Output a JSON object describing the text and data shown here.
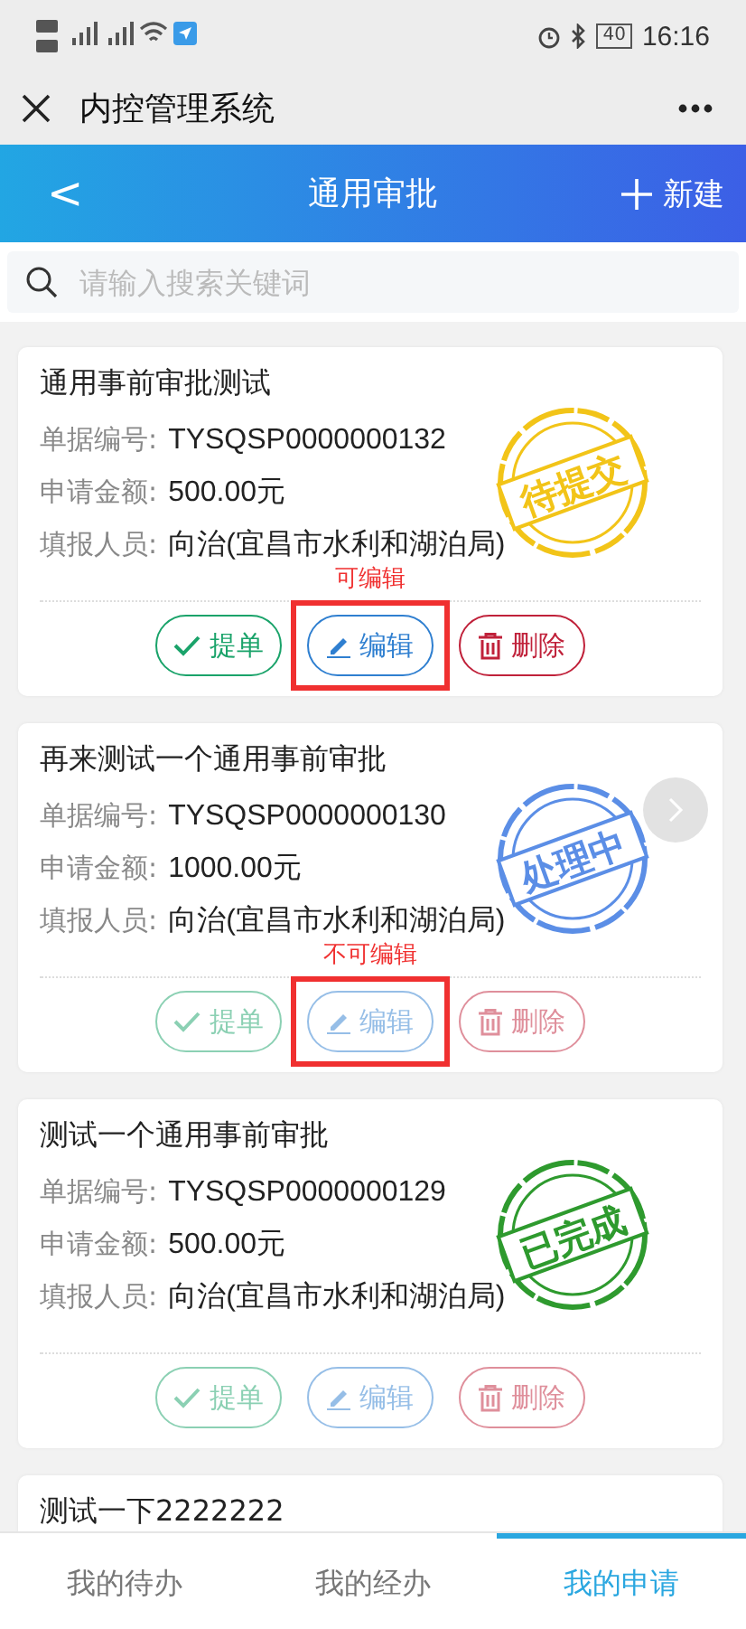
{
  "status_bar": {
    "battery": "40",
    "time": "16:16"
  },
  "title_bar": {
    "title": "内控管理系统"
  },
  "header": {
    "back": "<",
    "title": "通用审批",
    "new_label": "新建"
  },
  "search": {
    "placeholder": "请输入搜索关键词"
  },
  "cards": [
    {
      "title": "通用事前审批测试",
      "fields": [
        {
          "label": "单据编号:",
          "value": "TYSQSP0000000132"
        },
        {
          "label": "申请金额:",
          "value": "500.00元"
        },
        {
          "label": "填报人员:",
          "value": "向治(宜昌市水利和湖泊局)"
        }
      ],
      "stamp": {
        "text": "待提交",
        "color": "#f2c418"
      },
      "annotation": "可编辑",
      "disabled": false,
      "buttons": [
        {
          "kind": "submit",
          "label": "提单"
        },
        {
          "kind": "edit",
          "label": "编辑"
        },
        {
          "kind": "delete",
          "label": "删除"
        }
      ]
    },
    {
      "title": "再来测试一个通用事前审批",
      "fields": [
        {
          "label": "单据编号:",
          "value": "TYSQSP0000000130"
        },
        {
          "label": "申请金额:",
          "value": "1000.00元"
        },
        {
          "label": "填报人员:",
          "value": "向治(宜昌市水利和湖泊局)"
        }
      ],
      "stamp": {
        "text": "处理中",
        "color": "#5b8ee6"
      },
      "annotation": "不可编辑",
      "next_button": true,
      "disabled": true,
      "buttons": [
        {
          "kind": "submit",
          "label": "提单"
        },
        {
          "kind": "edit",
          "label": "编辑"
        },
        {
          "kind": "delete",
          "label": "删除"
        }
      ]
    },
    {
      "title": "测试一个通用事前审批",
      "fields": [
        {
          "label": "单据编号:",
          "value": "TYSQSP0000000129"
        },
        {
          "label": "申请金额:",
          "value": "500.00元"
        },
        {
          "label": "填报人员:",
          "value": "向治(宜昌市水利和湖泊局)"
        }
      ],
      "stamp": {
        "text": "已完成",
        "color": "#2e9a2e"
      },
      "disabled": true,
      "buttons": [
        {
          "kind": "submit",
          "label": "提单"
        },
        {
          "kind": "edit",
          "label": "编辑"
        },
        {
          "kind": "delete",
          "label": "删除"
        }
      ]
    },
    {
      "title": "测试一下2222222"
    }
  ],
  "tabs": [
    {
      "label": "我的待办",
      "selected": false
    },
    {
      "label": "我的经办",
      "selected": false
    },
    {
      "label": "我的申请",
      "selected": true
    }
  ]
}
